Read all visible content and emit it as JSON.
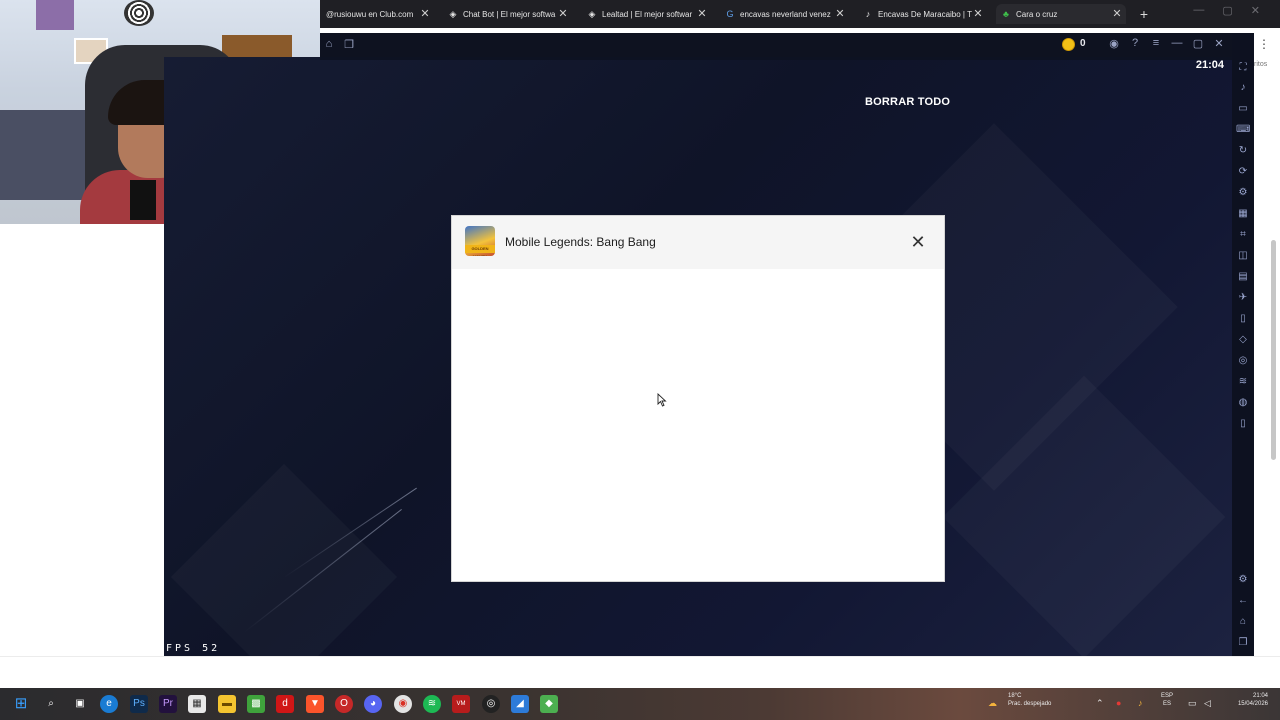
{
  "browser": {
    "tabs": [
      {
        "title": "@rusiouwu en Club.com",
        "icon": "club-favicon"
      },
      {
        "title": "Chat Bot | El mejor softwa",
        "icon": "bot-favicon"
      },
      {
        "title": "Lealtad | El mejor softwar",
        "icon": "bot-favicon"
      },
      {
        "title": "encavas neverland venez",
        "icon": "google-favicon"
      },
      {
        "title": "Encavas De Maracaibo | T",
        "icon": "tiktok-favicon"
      },
      {
        "title": "Cara o cruz",
        "icon": "clover-favicon"
      }
    ],
    "new_tab": "+"
  },
  "emulator": {
    "coins": "0",
    "clock": "21:04",
    "sidebar_partial_text": "ritos"
  },
  "game": {
    "clear_all": "BORRAR TODO",
    "fps_label": "FPS",
    "fps_value": "52"
  },
  "dialog": {
    "app_name": "Mobile Legends: Bang Bang",
    "icon_ribbon": "GOLDEN MONTH"
  },
  "taskbar": {
    "weather_temp": "18°C",
    "weather_desc": "Prac. despejado",
    "lang_1": "ESP",
    "lang_2": "ES",
    "time": "21:04",
    "date": "15/04/2026"
  }
}
